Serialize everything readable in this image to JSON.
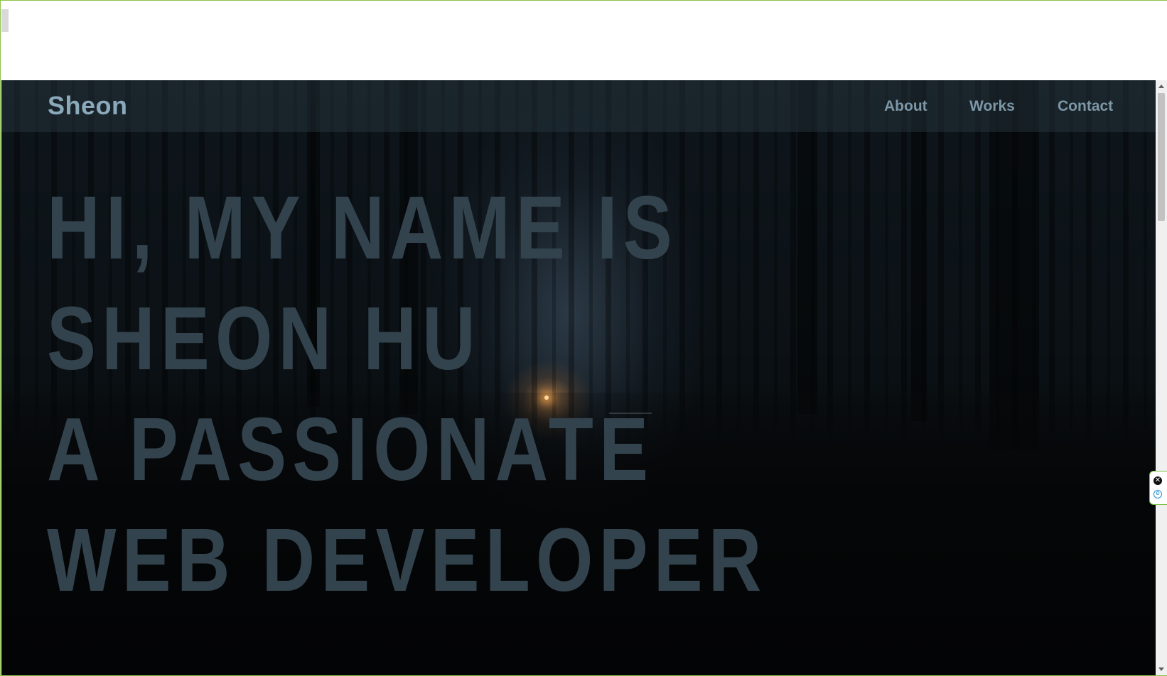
{
  "navbar": {
    "brand": "Sheon",
    "items": [
      {
        "label": "About"
      },
      {
        "label": "Works"
      },
      {
        "label": "Contact"
      }
    ]
  },
  "hero": {
    "lines": [
      "HI, MY NAME IS",
      "SHEON HU",
      "A PASSIONATE",
      "WEB DEVELOPER"
    ]
  },
  "side_widget": {
    "close_icon": "close-icon",
    "extension_icon": "e-icon",
    "close_glyph": "✕",
    "extension_glyph": "e"
  },
  "colors": {
    "brand_text": "#8aa9b9",
    "nav_text": "#7d97a6",
    "hero_text": "#33434e",
    "frame_border": "#8bc34a",
    "widget_border": "#7cc242"
  }
}
